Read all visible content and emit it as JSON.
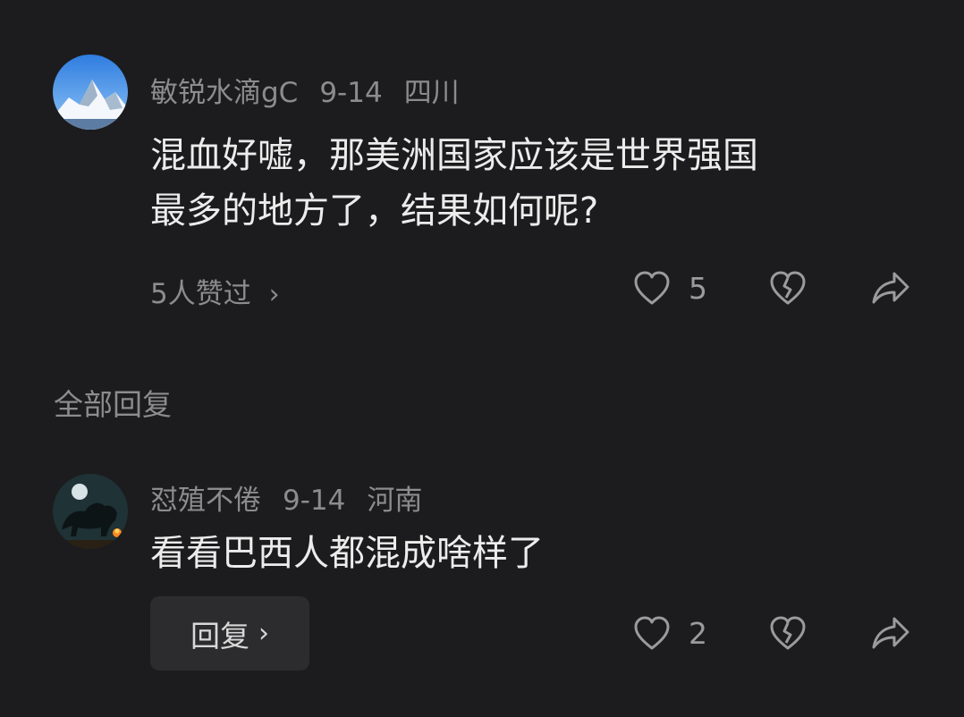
{
  "comment": {
    "username": "敏锐水滴gC",
    "date": "9-14",
    "location": "四川",
    "text_line1": "混血好嘘，那美洲国家应该是世界强国",
    "text_line2": "最多的地方了，结果如何呢?",
    "liked_by": "5人赞过",
    "like_count": "5"
  },
  "replies_header": "全部回复",
  "reply": {
    "username": "怼殖不倦",
    "date": "9-14",
    "location": "河南",
    "text": "看看巴西人都混成啥样了",
    "reply_button": "回复",
    "like_count": "2"
  },
  "icons": {
    "chevron": "›",
    "like": "heart-outline-icon",
    "dislike": "broken-heart-icon",
    "share": "share-arrow-icon"
  },
  "colors": {
    "background": "#1c1c1e",
    "meta_text": "#8c8c8e",
    "body_text": "#ececec",
    "button_bg": "#2c2c2e"
  }
}
